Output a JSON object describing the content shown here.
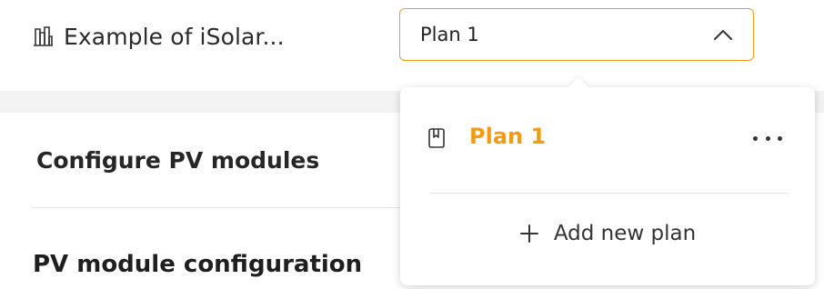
{
  "header": {
    "project_icon": "building-chart-icon",
    "project_title": "Example of iSolar...",
    "plan_select": {
      "value": "Plan 1",
      "chevron_icon": "chevron-up-icon"
    }
  },
  "content": {
    "section_heading": "Configure PV modules",
    "subheading": "PV module configuration"
  },
  "dropdown": {
    "plans": [
      {
        "icon": "bookmark-icon",
        "name": "Plan 1",
        "active": true,
        "more_icon": "more-horizontal-icon"
      }
    ],
    "add_plan": {
      "icon": "plus-icon",
      "label": "Add new plan"
    }
  },
  "colors": {
    "accent": "#f39c12",
    "text": "#222222",
    "band": "#f3f3f3"
  }
}
